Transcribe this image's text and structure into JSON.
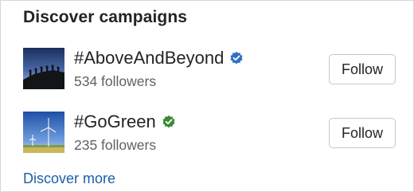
{
  "section": {
    "title": "Discover campaigns"
  },
  "campaigns": [
    {
      "name": "#AboveAndBeyond",
      "followers": "534 followers",
      "follow_label": "Follow",
      "badge_color": "#2f6fc4",
      "image": "hikers-silhouette-image"
    },
    {
      "name": "#GoGreen",
      "followers": "235 followers",
      "follow_label": "Follow",
      "badge_color": "#3b8a35",
      "image": "wind-turbines-image"
    }
  ],
  "footer": {
    "discover_more": "Discover more"
  }
}
